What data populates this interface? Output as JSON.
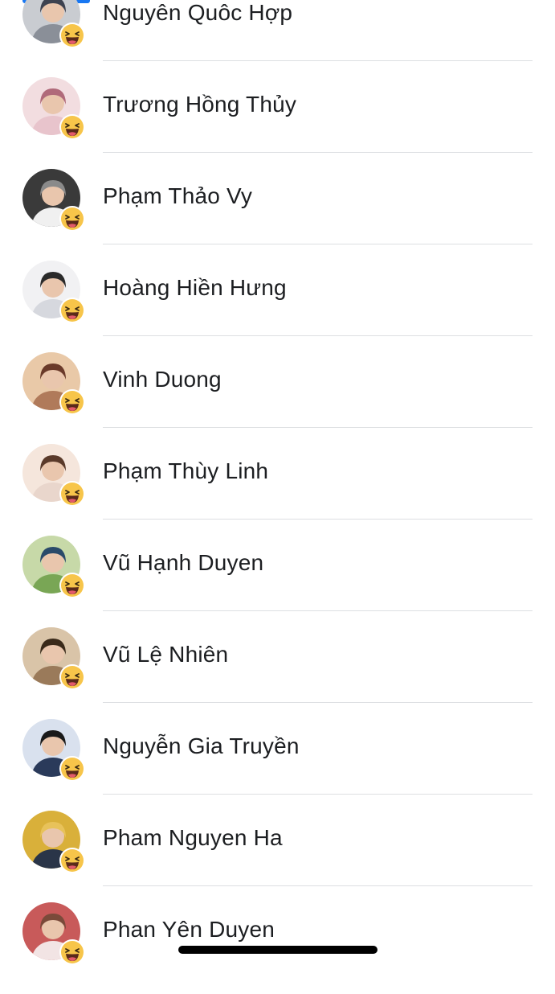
{
  "reactions_list": {
    "items": [
      {
        "name": "Nguyên Quôc Hợp",
        "reaction": "haha",
        "avatar_color": "#8a8f98"
      },
      {
        "name": "Trương Hồng Thủy",
        "reaction": "haha",
        "avatar_color": "#d9a5b0"
      },
      {
        "name": "Phạm Thảo Vy",
        "reaction": "haha",
        "avatar_color": "#5a5a5a"
      },
      {
        "name": "Hoàng Hiền Hưng",
        "reaction": "haha",
        "avatar_color": "#c7c9cf"
      },
      {
        "name": "Vinh Duong",
        "reaction": "haha",
        "avatar_color": "#b07a5a"
      },
      {
        "name": "Phạm Thùy Linh",
        "reaction": "haha",
        "avatar_color": "#d8b7a8"
      },
      {
        "name": "Vũ Hạnh Duyen",
        "reaction": "haha",
        "avatar_color": "#6d9a4e"
      },
      {
        "name": "Vũ Lệ Nhiên",
        "reaction": "haha",
        "avatar_color": "#8b6a4a"
      },
      {
        "name": "Nguyễn Gia Truyền",
        "reaction": "haha",
        "avatar_color": "#4a5a7a"
      },
      {
        "name": "Pham Nguyen Ha",
        "reaction": "haha",
        "avatar_color": "#3a4a5a"
      },
      {
        "name": "Phan Yên Duyen",
        "reaction": "haha",
        "avatar_color": "#c85a5a"
      }
    ]
  },
  "colors": {
    "accent": "#1877f2",
    "divider": "#dddfe2",
    "text": "#1c1e21",
    "haha_face": "#f7c54a"
  }
}
